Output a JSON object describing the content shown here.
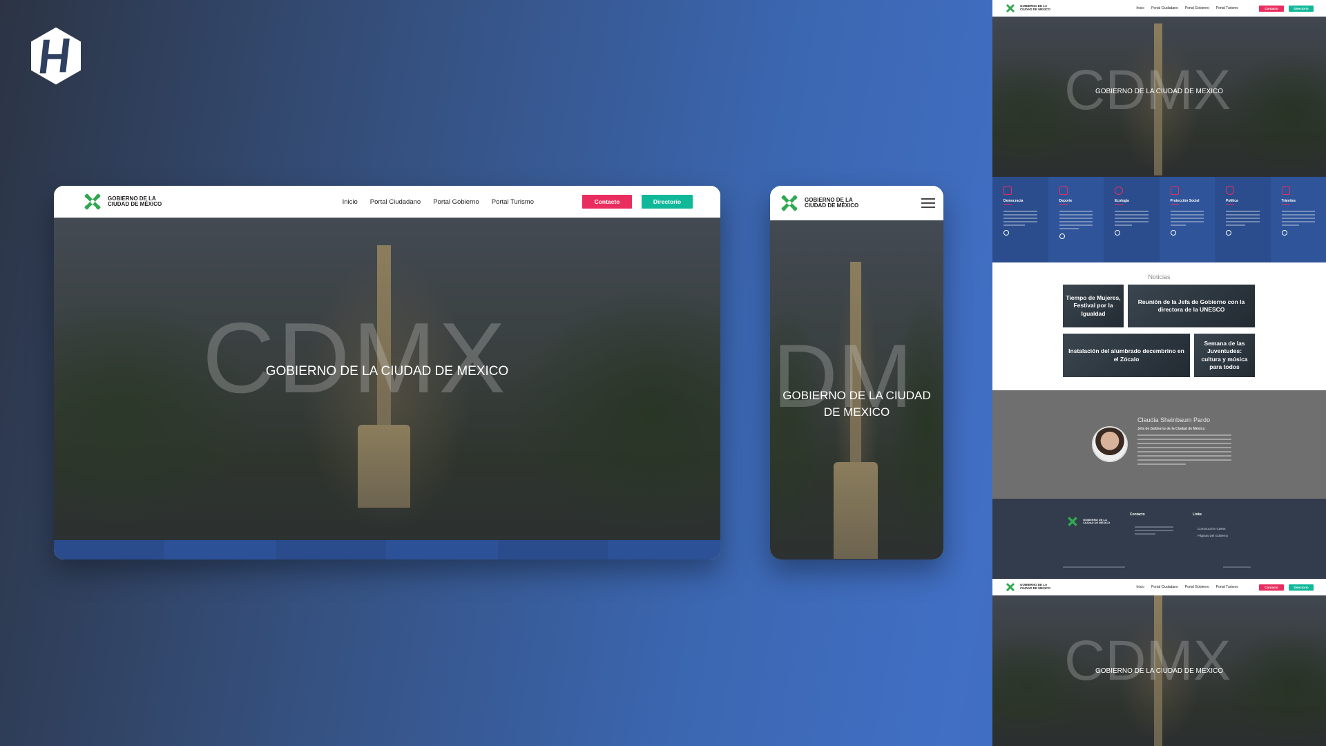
{
  "brand": {
    "logo_icon": "hw-monogram-logo"
  },
  "site": {
    "logo_text": "GOBIERNO DE LA\nCIUDAD DE MÉXICO",
    "nav": [
      "Inicio",
      "Portal Ciudadano",
      "Portal Gobierno",
      "Portal Turismo"
    ],
    "buttons": {
      "contact": "Contacto",
      "directory": "Directorio"
    },
    "hero": {
      "watermark": "CDMX",
      "title": "GOBIERNO DE LA CIUDAD DE MEXICO"
    },
    "mobile": {
      "watermark": "DM",
      "title": "GOBIERNO DE LA CIUDAD DE MEXICO",
      "menu_icon": "hamburger-icon"
    },
    "services": [
      {
        "title": "Democracia",
        "icon": "edit-icon"
      },
      {
        "title": "Deporte",
        "icon": "shoe-icon"
      },
      {
        "title": "Ecología",
        "icon": "globe-icon"
      },
      {
        "title": "Protección Social",
        "icon": "thumbs-up-icon"
      },
      {
        "title": "Política",
        "icon": "shield-icon"
      },
      {
        "title": "Trámites",
        "icon": "checklist-icon"
      }
    ],
    "news": {
      "title": "Noticias",
      "items": [
        "Tiempo de Mujeres, Festival por la Igualdad",
        "Reunión de la Jefa de Gobierno con la directora de la UNESCO",
        "Instalación del alumbrado decembrino en el Zócalo",
        "Semana de las Juventudes: cultura y música para todos"
      ]
    },
    "bio": {
      "name": "Claudia Sheinbaum Pardo",
      "role": "Jefa de Gobierno de la Ciudad de México"
    },
    "footer": {
      "contact_heading": "Contacto",
      "links_heading": "Links",
      "links": [
        "Construcción CDMX",
        "Páginas Del Gobierno"
      ]
    },
    "colors": {
      "pink": "#ea2d5f",
      "teal": "#10b89a",
      "blue": "#2b4d8d",
      "green": "#2fa84f"
    }
  }
}
